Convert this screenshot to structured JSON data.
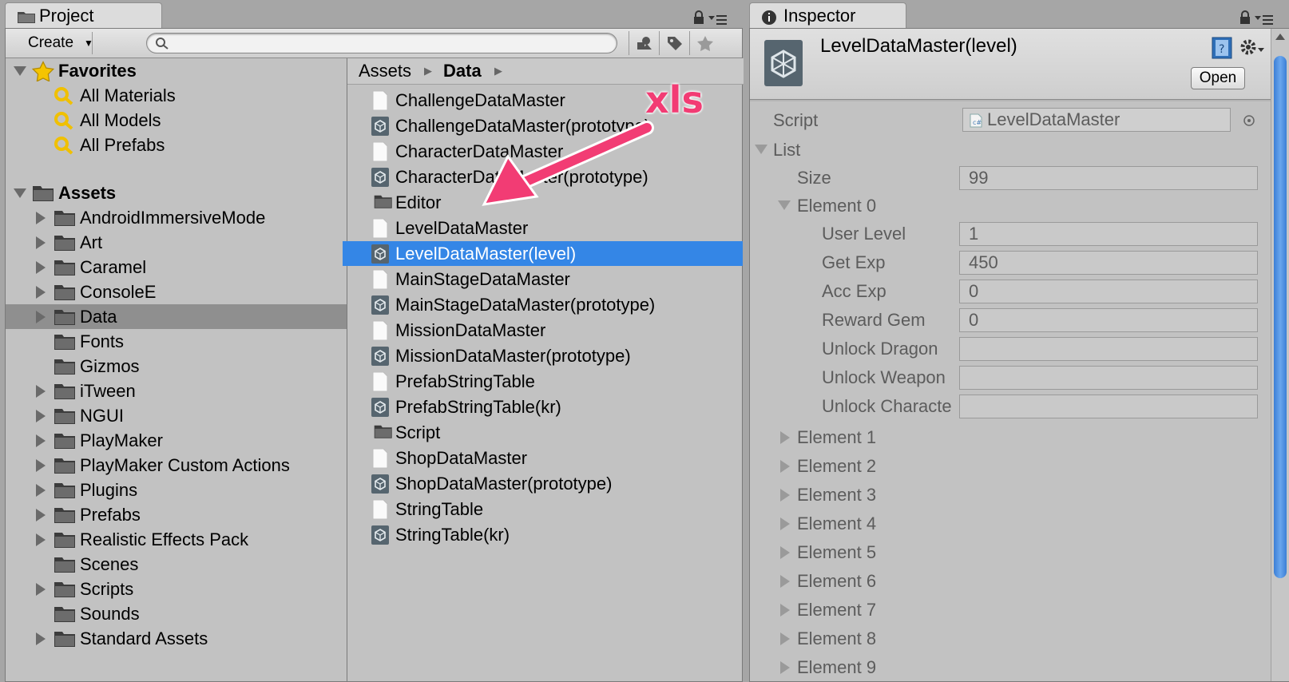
{
  "project": {
    "tab_label": "Project",
    "create_label": "Create",
    "search_placeholder": "",
    "favorites": {
      "label": "Favorites",
      "items": [
        "All Materials",
        "All Models",
        "All Prefabs"
      ]
    },
    "assets": {
      "label": "Assets",
      "folders": [
        {
          "name": "AndroidImmersiveMode",
          "expandable": true
        },
        {
          "name": "Art",
          "expandable": true
        },
        {
          "name": "Caramel",
          "expandable": true
        },
        {
          "name": "ConsoleE",
          "expandable": true
        },
        {
          "name": "Data",
          "expandable": true,
          "selected": true
        },
        {
          "name": "Fonts",
          "expandable": false
        },
        {
          "name": "Gizmos",
          "expandable": false
        },
        {
          "name": "iTween",
          "expandable": true
        },
        {
          "name": "NGUI",
          "expandable": true
        },
        {
          "name": "PlayMaker",
          "expandable": true
        },
        {
          "name": "PlayMaker Custom Actions",
          "expandable": true
        },
        {
          "name": "Plugins",
          "expandable": true
        },
        {
          "name": "Prefabs",
          "expandable": true
        },
        {
          "name": "Realistic Effects Pack",
          "expandable": true
        },
        {
          "name": "Scenes",
          "expandable": false
        },
        {
          "name": "Scripts",
          "expandable": true
        },
        {
          "name": "Sounds",
          "expandable": false
        },
        {
          "name": "Standard Assets",
          "expandable": true
        }
      ]
    },
    "breadcrumb": [
      "Assets",
      "Data"
    ],
    "files": [
      {
        "name": "ChallengeDataMaster",
        "icon": "document-icon"
      },
      {
        "name": "ChallengeDataMaster(prototype)",
        "icon": "unity-asset-icon"
      },
      {
        "name": "CharacterDataMaster",
        "icon": "document-icon"
      },
      {
        "name": "CharacterDataMaster(prototype)",
        "icon": "unity-asset-icon"
      },
      {
        "name": "Editor",
        "icon": "folder-icon"
      },
      {
        "name": "LevelDataMaster",
        "icon": "document-icon"
      },
      {
        "name": "LevelDataMaster(level)",
        "icon": "unity-asset-icon",
        "selected": true
      },
      {
        "name": "MainStageDataMaster",
        "icon": "document-icon"
      },
      {
        "name": "MainStageDataMaster(prototype)",
        "icon": "unity-asset-icon"
      },
      {
        "name": "MissionDataMaster",
        "icon": "document-icon"
      },
      {
        "name": "MissionDataMaster(prototype)",
        "icon": "unity-asset-icon"
      },
      {
        "name": "PrefabStringTable",
        "icon": "document-icon"
      },
      {
        "name": "PrefabStringTable(kr)",
        "icon": "unity-asset-icon"
      },
      {
        "name": "Script",
        "icon": "folder-icon"
      },
      {
        "name": "ShopDataMaster",
        "icon": "document-icon"
      },
      {
        "name": "ShopDataMaster(prototype)",
        "icon": "unity-asset-icon"
      },
      {
        "name": "StringTable",
        "icon": "document-icon"
      },
      {
        "name": "StringTable(kr)",
        "icon": "unity-asset-icon"
      }
    ],
    "annotation": {
      "text": "xls",
      "color": "#f23c74"
    }
  },
  "inspector": {
    "tab_label": "Inspector",
    "title": "LevelDataMaster(level)",
    "open_label": "Open",
    "script_label": "Script",
    "script_value": "LevelDataMaster",
    "list_label": "List",
    "size_label": "Size",
    "size_value": "99",
    "element0_label": "Element 0",
    "fields": [
      {
        "label": "User Level",
        "value": "1"
      },
      {
        "label": "Get Exp",
        "value": "450"
      },
      {
        "label": "Acc Exp",
        "value": "0"
      },
      {
        "label": "Reward Gem",
        "value": "0"
      },
      {
        "label": "Unlock Dragon",
        "value": ""
      },
      {
        "label": "Unlock Weapon",
        "value": ""
      },
      {
        "label": "Unlock Characte",
        "value": ""
      }
    ],
    "collapsed_elements": [
      "Element 1",
      "Element 2",
      "Element 3",
      "Element 4",
      "Element 5",
      "Element 6",
      "Element 7",
      "Element 8",
      "Element 9"
    ]
  },
  "colors": {
    "selection_blue": "#3486e6",
    "tree_selection": "#8f8f8f",
    "panel_bg": "#c2c2c2"
  }
}
